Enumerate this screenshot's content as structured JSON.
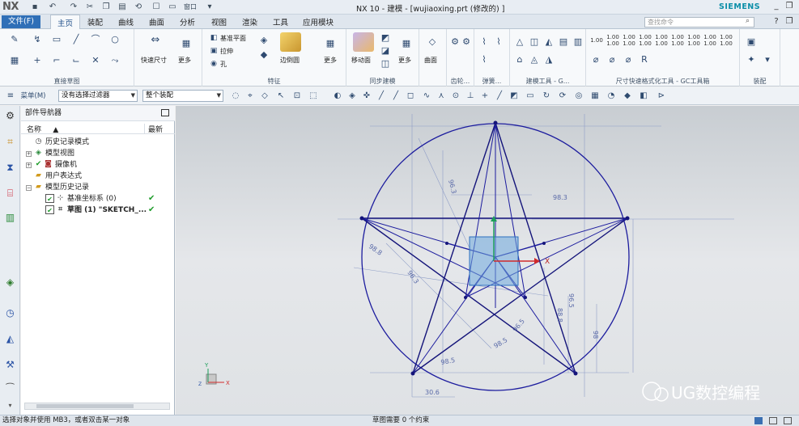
{
  "app": {
    "logo": "NX",
    "window_title": "NX 10 - 建模 - [wujiaoxing.prt  (修改的) ]",
    "brand": "SIEMENS",
    "window_menu": "窗口"
  },
  "tabs": {
    "file": "文件(F)",
    "items": [
      "主页",
      "装配",
      "曲线",
      "曲面",
      "分析",
      "视图",
      "渲染",
      "工具",
      "应用模块"
    ],
    "active": "主页",
    "search_placeholder": "查找命令"
  },
  "ribbon": {
    "groups": {
      "direct_sketch": "直接草图",
      "feature": "特征",
      "sync_modeling": "同步建模",
      "gear": "齿轮...",
      "spring": "弹簧...",
      "build_tools": "建模工具 - G...",
      "dim_tools": "尺寸快速格式化工具 - GC工具箱",
      "assembly": "装配"
    },
    "labels": {
      "quick_dim": "快速尺寸",
      "more1": "更多",
      "datum_plane": "基准平面",
      "pull": "拉伸",
      "hole": "孔",
      "edge_blend": "边倒圆",
      "more2": "更多",
      "move_face": "移动面",
      "more3": "更多",
      "surface": "曲面"
    },
    "dim_minis": [
      "1.00",
      "1.00\n1.00",
      "1.00\n1.00",
      "1.00\n1.00",
      "1.00\n1.00",
      "1.00\n1.00",
      "1.00\n1.00",
      "1.00\n1.00",
      "1.00\n1.00",
      "1.00\n1.00",
      "1.00\n1.00"
    ]
  },
  "cmdbar": {
    "menu": "菜单(M)",
    "filter": "没有选择过滤器",
    "scope": "整个装配"
  },
  "navigator": {
    "title": "部件导航器",
    "col_name": "名称",
    "col_latest": "最新",
    "rows": [
      {
        "label": "历史记录模式",
        "indent": 0,
        "icon": "clock-icon"
      },
      {
        "label": "模型视图",
        "indent": 0,
        "icon": "views-icon",
        "expander": "+"
      },
      {
        "label": "摄像机",
        "indent": 0,
        "icon": "camera-icon",
        "expander": "+",
        "check": true
      },
      {
        "label": "用户表达式",
        "indent": 0,
        "icon": "folder-icon"
      },
      {
        "label": "模型历史记录",
        "indent": 0,
        "icon": "folder-icon",
        "expander": "−"
      },
      {
        "label": "基准坐标系 (0)",
        "indent": 1,
        "icon": "csys-icon",
        "latest": "✔"
      },
      {
        "label": "草图 (1) \"SKETCH_...",
        "indent": 1,
        "icon": "sketch-icon",
        "latest": "✔",
        "bold": true
      }
    ]
  },
  "status": {
    "left": "选择对象并使用 MB3，或者双击某一对象",
    "mid": "草图需要 0 个约束"
  },
  "sketch": {
    "dim_labels": [
      "96.3",
      "98.3",
      "96.3",
      "98.5",
      "88.8",
      "96.5",
      "98.5",
      "96.5",
      "30.6",
      "98.8",
      "98"
    ],
    "axis_x": "X",
    "axis_y": "Y",
    "axis_z": "Z",
    "watermark": "UG数控编程"
  }
}
